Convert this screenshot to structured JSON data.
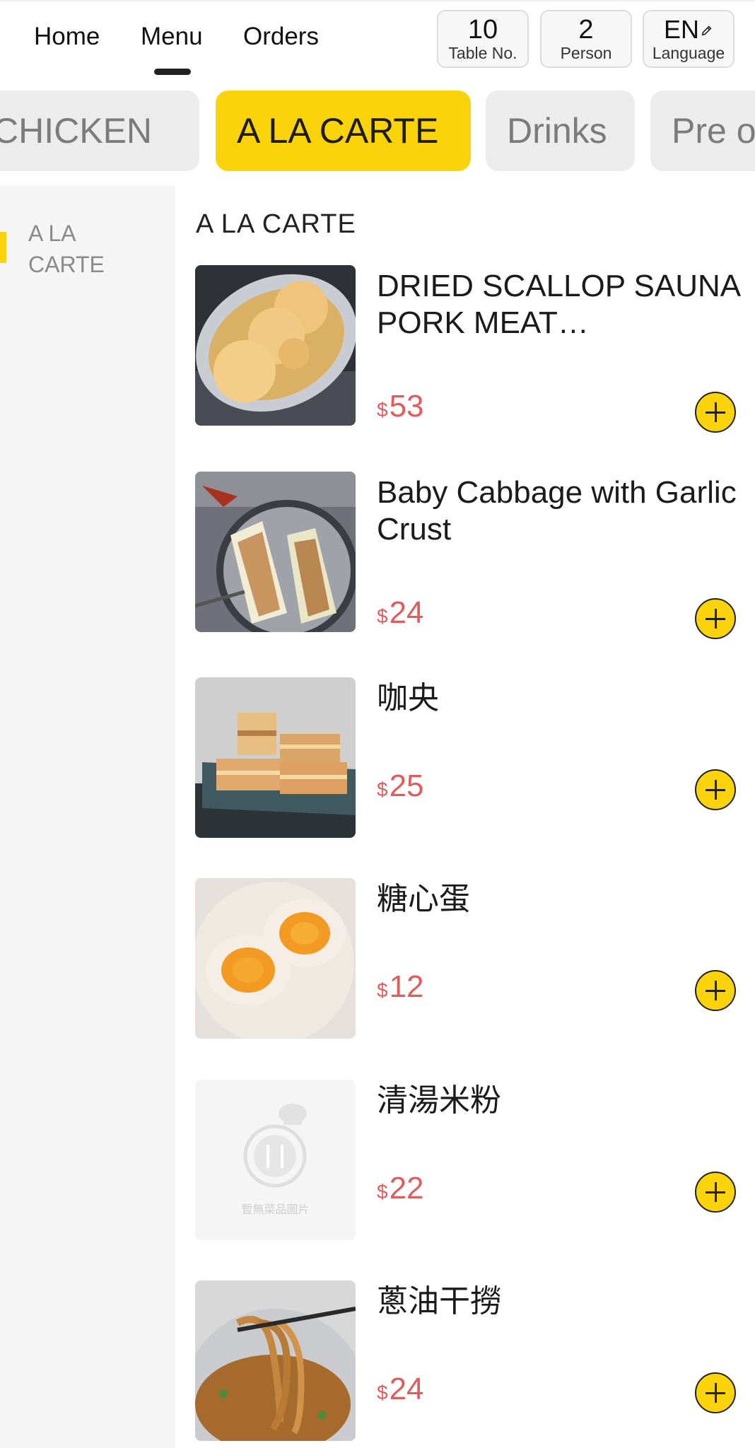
{
  "nav": {
    "tabs": [
      {
        "label": "Home"
      },
      {
        "label": "Menu"
      },
      {
        "label": "Orders"
      }
    ],
    "active_tab": "Menu",
    "table": {
      "value": "10",
      "label": "Table No."
    },
    "person": {
      "value": "2",
      "label": "Person"
    },
    "language": {
      "value": "EN",
      "label": "Language",
      "icon": "pencil-icon"
    }
  },
  "categories": [
    {
      "label": "CHICKEN"
    },
    {
      "label": "A LA CARTE"
    },
    {
      "label": "Drinks"
    },
    {
      "label": "Pre o"
    }
  ],
  "active_category": "A LA CARTE",
  "sidebar": {
    "items": [
      {
        "label": "A LA CARTE"
      }
    ]
  },
  "main": {
    "section_title": "A LA CARTE",
    "currency": "$",
    "items": [
      {
        "name": "DRIED SCALLOP SAUNA PORK MEAT…",
        "price": "53"
      },
      {
        "name": "Baby Cabbage with Garlic Crust",
        "price": "24"
      },
      {
        "name": "咖央",
        "price": "25"
      },
      {
        "name": "糖心蛋",
        "price": "12"
      },
      {
        "name": "清湯米粉",
        "price": "22",
        "placeholder_text": "暫無菜品圖片"
      },
      {
        "name": "蔥油干撈",
        "price": "24"
      }
    ]
  },
  "colors": {
    "accent": "#fbd30a",
    "price": "#e05d5d",
    "sidebar_bg": "#f5f5f5"
  }
}
